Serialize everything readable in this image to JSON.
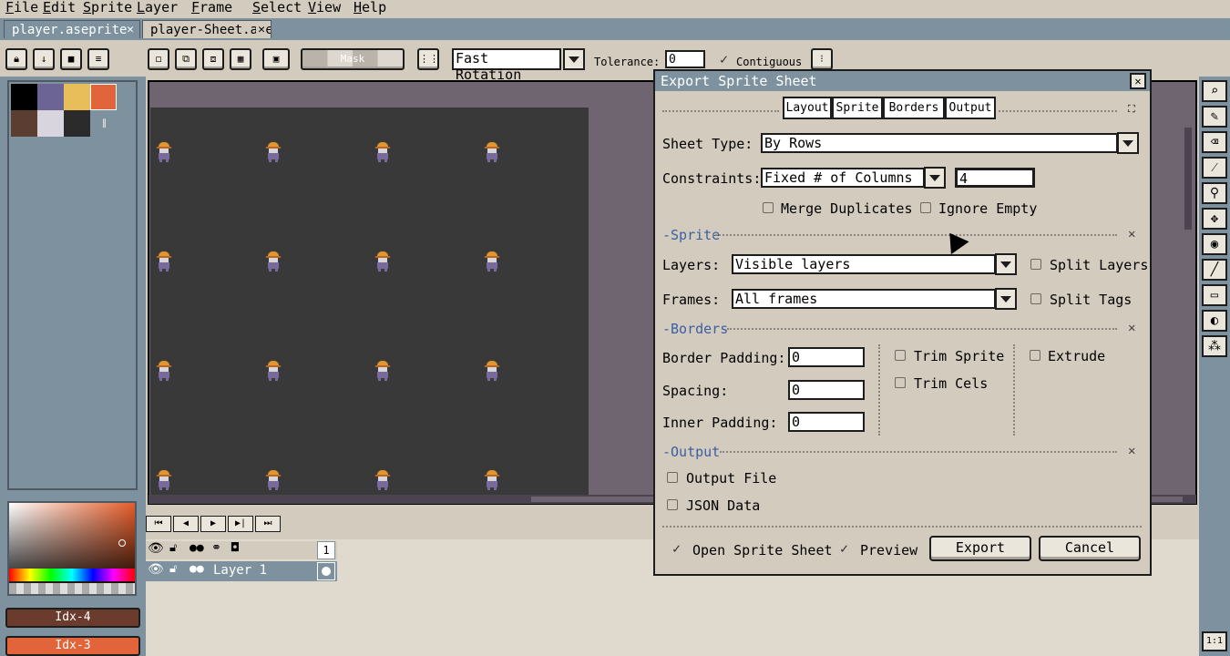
{
  "menu": [
    "File",
    "Edit",
    "Sprite",
    "Layer",
    "Frame",
    "Select",
    "View",
    "Help"
  ],
  "tabs": [
    {
      "label": "player.aseprite",
      "close": "✕"
    },
    {
      "label": "player-Sheet.aseprite",
      "close": "✕"
    }
  ],
  "toolbar": {
    "mask_label": "Mask",
    "rotation": "Fast Rotation",
    "tolerance_label": "Tolerance:",
    "tolerance_value": "0",
    "continuous_label": "Contiguous"
  },
  "colors": {
    "swatches": [
      "#000000",
      "#6c6495",
      "#e7be5a",
      "#e2643a",
      "#5b3d31",
      "#d9d5df",
      "#2b2b2b"
    ],
    "accent": "#7d929e"
  },
  "palette_buttons": [
    {
      "label": "Idx-4",
      "color": "#6b3c2e"
    },
    {
      "label": "Idx-3",
      "color": "#e2643a"
    }
  ],
  "timeline": {
    "frame_number": "1",
    "layer_name": "Layer 1"
  },
  "dialog": {
    "title": "Export Sprite Sheet",
    "close": "✕",
    "tabs": [
      "Layout",
      "Sprite",
      "Borders",
      "Output"
    ],
    "layout": {
      "sheet_type_label": "Sheet Type:",
      "sheet_type_value": "By Rows",
      "constraints_label": "Constraints:",
      "constraints_value": "Fixed # of Columns",
      "columns_value": "4",
      "merge_duplicates": "Merge Duplicates",
      "ignore_empty": "Ignore Empty"
    },
    "sprite": {
      "section": "-Sprite",
      "layers_label": "Layers:",
      "layers_value": "Visible layers",
      "split_layers": "Split Layers",
      "frames_label": "Frames:",
      "frames_value": "All frames",
      "split_tags": "Split Tags"
    },
    "borders": {
      "section": "-Borders",
      "border_padding_label": "Border Padding:",
      "border_padding_value": "0",
      "spacing_label": "Spacing:",
      "spacing_value": "0",
      "inner_padding_label": "Inner Padding:",
      "inner_padding_value": "0",
      "trim_sprite": "Trim Sprite",
      "trim_cels": "Trim Cels",
      "extrude": "Extrude"
    },
    "output": {
      "section": "-Output",
      "output_file": "Output File",
      "json_data": "JSON Data"
    },
    "footer": {
      "open_sprite_sheet": "Open Sprite Sheet",
      "preview": "Preview",
      "export_button": "Export",
      "cancel_button": "Cancel"
    }
  },
  "zoom_button": "1:1"
}
